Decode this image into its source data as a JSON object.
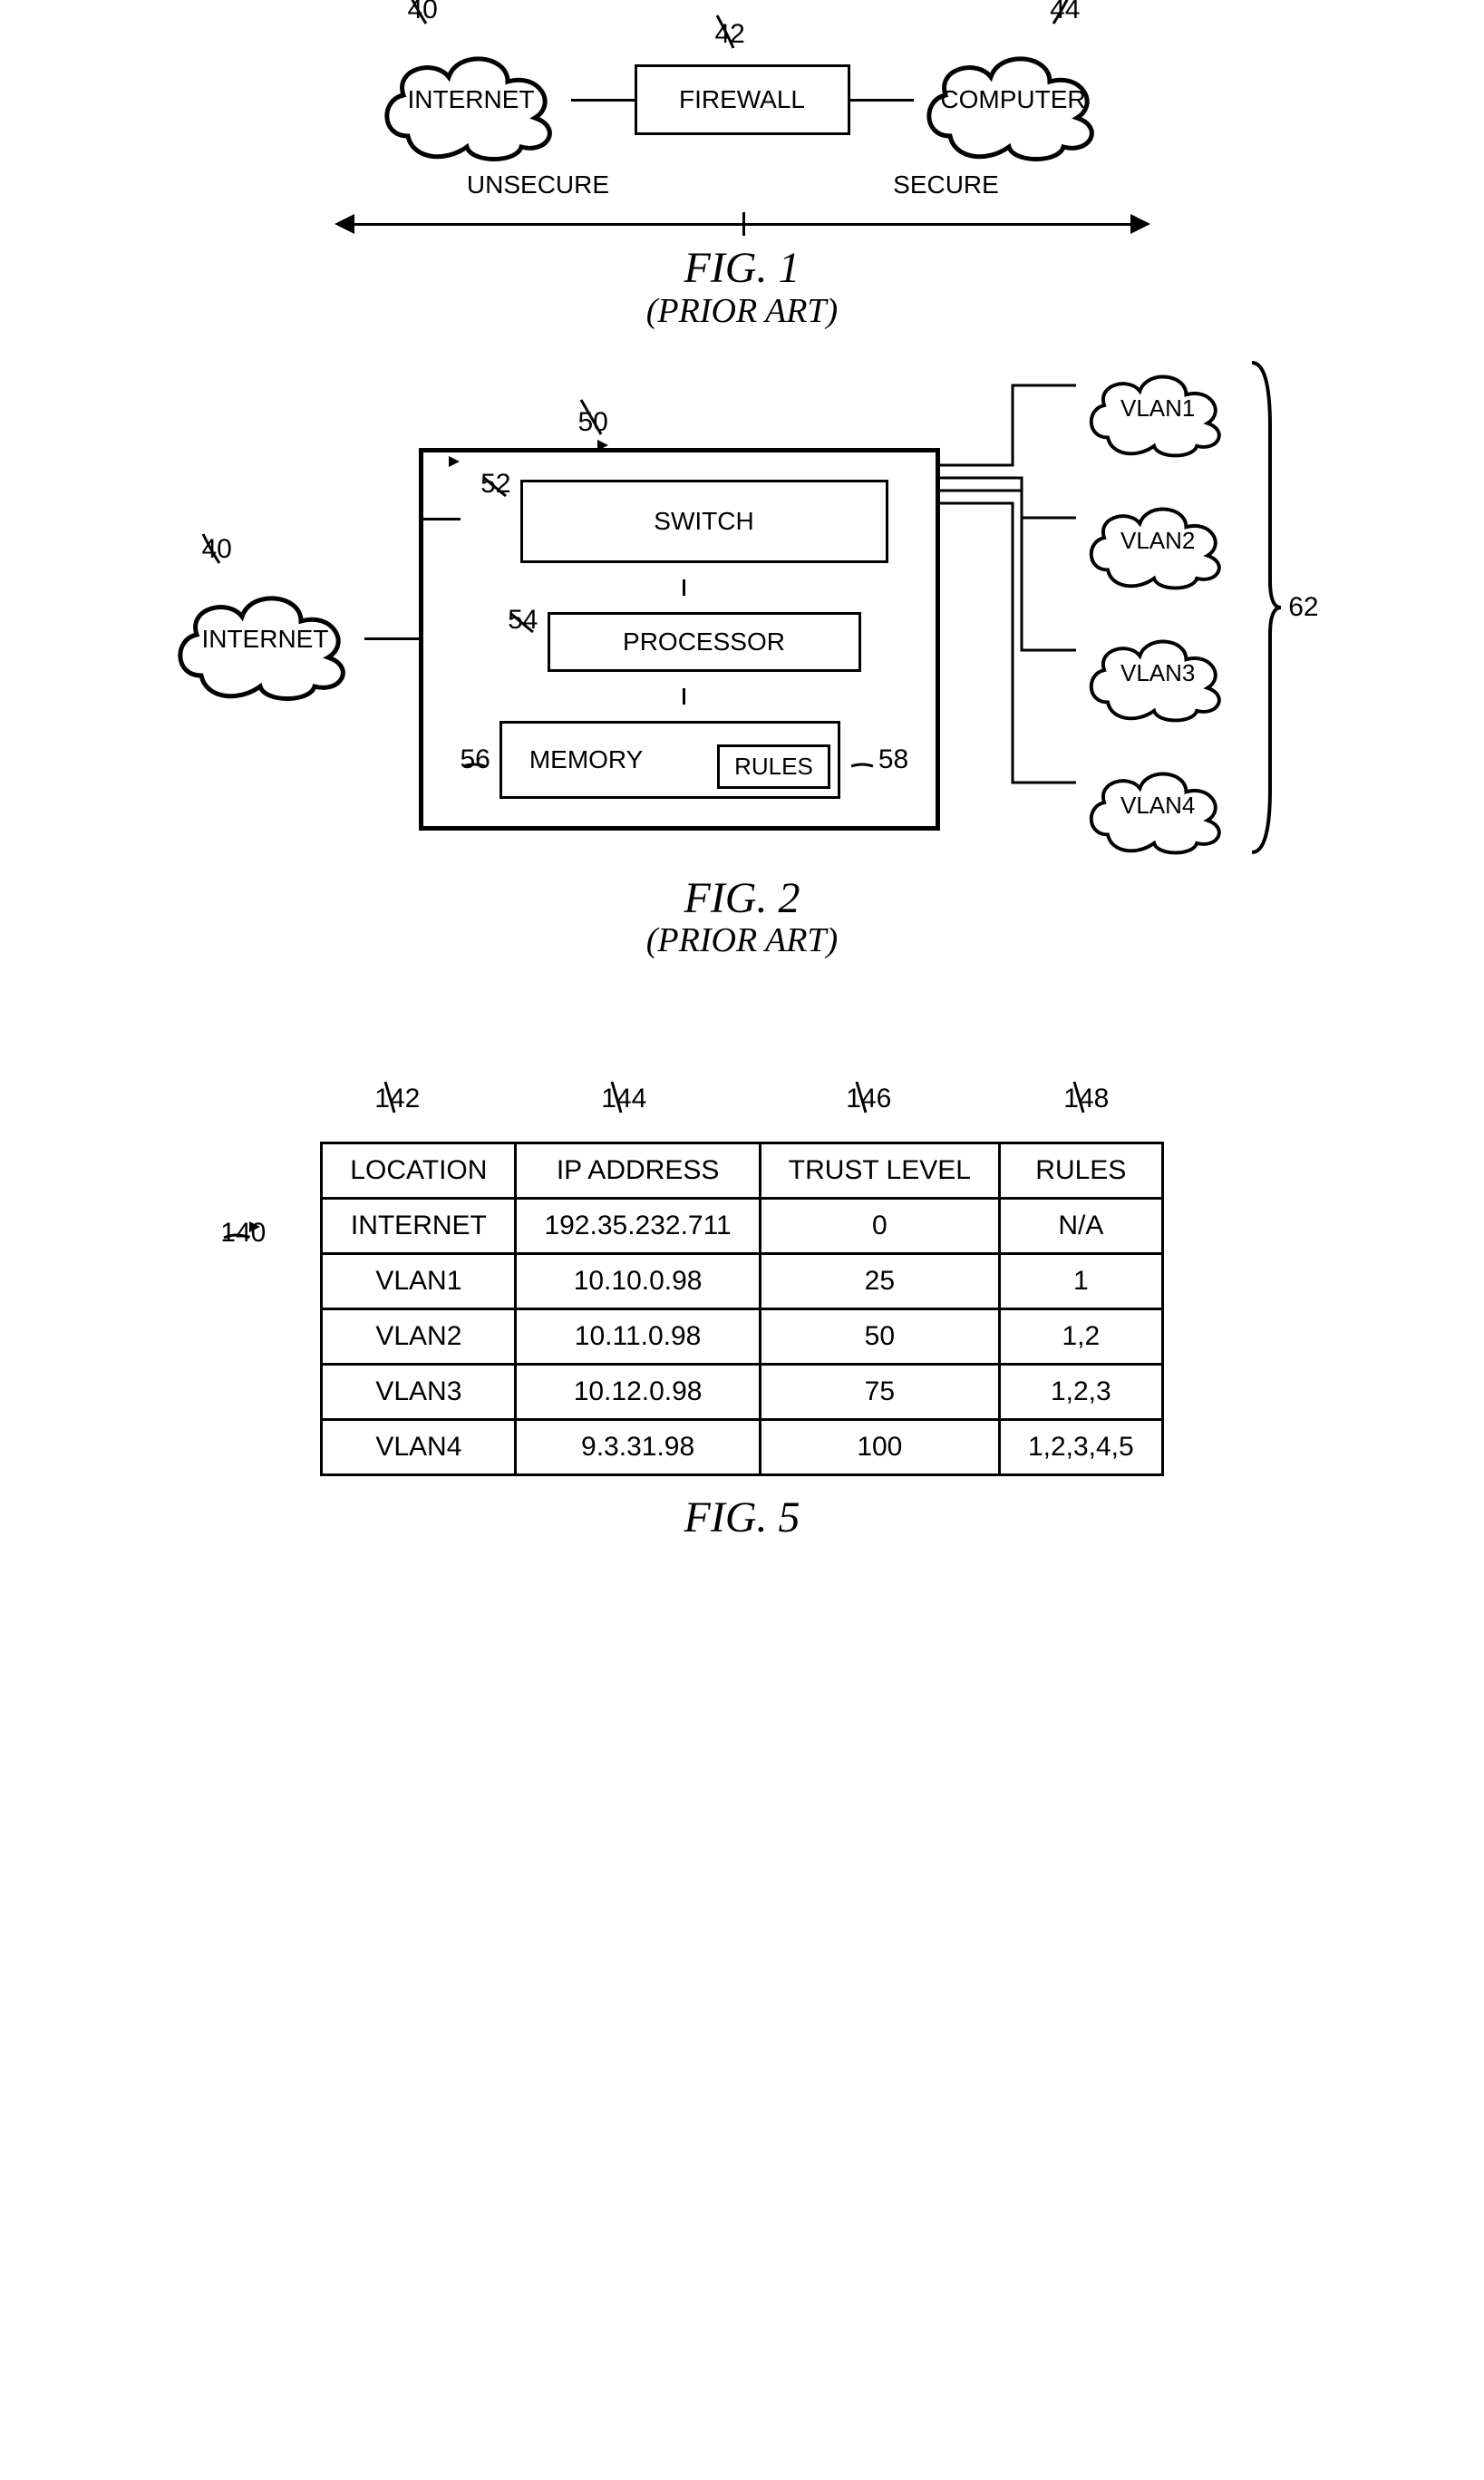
{
  "fig1": {
    "ref_internet": "40",
    "ref_firewall": "42",
    "ref_computer": "44",
    "internet_label": "INTERNET",
    "firewall_label": "FIREWALL",
    "computer_label": "COMPUTER",
    "unsecure": "UNSECURE",
    "secure": "SECURE",
    "caption_main": "FIG. 1",
    "caption_sub": "(PRIOR ART)"
  },
  "fig2": {
    "ref_internet": "40",
    "ref_box": "50",
    "ref_switch": "52",
    "ref_processor": "54",
    "ref_memory": "56",
    "ref_rules": "58",
    "ref_vlans": "62",
    "internet_label": "INTERNET",
    "switch_label": "SWITCH",
    "processor_label": "PROCESSOR",
    "memory_label": "MEMORY",
    "rules_label": "RULES",
    "vlan_labels": [
      "VLAN1",
      "VLAN2",
      "VLAN3",
      "VLAN4"
    ],
    "caption_main": "FIG. 2",
    "caption_sub": "(PRIOR ART)"
  },
  "fig5": {
    "ref_table": "140",
    "col_refs": [
      "142",
      "144",
      "146",
      "148"
    ],
    "caption_main": "FIG. 5"
  },
  "chart_data": {
    "type": "table",
    "title": "FIG. 5",
    "columns": [
      "LOCATION",
      "IP ADDRESS",
      "TRUST LEVEL",
      "RULES"
    ],
    "rows": [
      {
        "LOCATION": "INTERNET",
        "IP ADDRESS": "192.35.232.711",
        "TRUST LEVEL": "0",
        "RULES": "N/A"
      },
      {
        "LOCATION": "VLAN1",
        "IP ADDRESS": "10.10.0.98",
        "TRUST LEVEL": "25",
        "RULES": "1"
      },
      {
        "LOCATION": "VLAN2",
        "IP ADDRESS": "10.11.0.98",
        "TRUST LEVEL": "50",
        "RULES": "1,2"
      },
      {
        "LOCATION": "VLAN3",
        "IP ADDRESS": "10.12.0.98",
        "TRUST LEVEL": "75",
        "RULES": "1,2,3"
      },
      {
        "LOCATION": "VLAN4",
        "IP ADDRESS": "9.3.31.98",
        "TRUST LEVEL": "100",
        "RULES": "1,2,3,4,5"
      }
    ]
  }
}
